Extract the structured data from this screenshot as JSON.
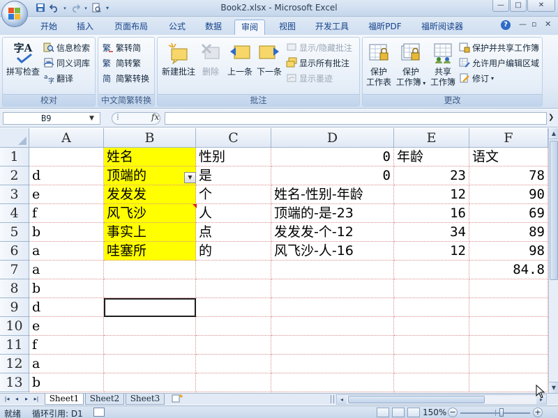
{
  "window": {
    "title": "Book2.xlsx - Microsoft Excel",
    "min_glyph": "—",
    "max_glyph": "□",
    "close_glyph": "✕"
  },
  "qat": {
    "save_icon": "save-icon",
    "undo_icon": "undo-icon",
    "redo_icon": "redo-icon"
  },
  "tabs": [
    {
      "label": "开始"
    },
    {
      "label": "插入"
    },
    {
      "label": "页面布局"
    },
    {
      "label": "公式"
    },
    {
      "label": "数据"
    },
    {
      "label": "审阅",
      "active": true
    },
    {
      "label": "视图"
    },
    {
      "label": "开发工具"
    },
    {
      "label": "福昕PDF"
    },
    {
      "label": "福昕阅读器"
    }
  ],
  "help_glyph": "?",
  "ribbon": {
    "proofing": {
      "label": "校对",
      "spell": "拼写检查",
      "spell_glyph": "字A",
      "research": "信息检索",
      "thesaurus": "同义词库",
      "translate": "翻译"
    },
    "chinese": {
      "label": "中文简繁转换",
      "to_simplified": "繁转简",
      "to_traditional": "简转繁",
      "convert": "简繁转换"
    },
    "comments": {
      "label": "批注",
      "new": "新建批注",
      "delete": "删除",
      "previous": "上一条",
      "next": "下一条",
      "show_hide": "显示/隐藏批注",
      "show_all": "显示所有批注",
      "show_ink": "显示墨迹"
    },
    "changes": {
      "label": "更改",
      "protect_sheet_1": "保护",
      "protect_sheet_2": "工作表",
      "protect_book_1": "保护",
      "protect_book_2": "工作簿",
      "share_1": "共享",
      "share_2": "工作簿",
      "protect_share": "保护并共享工作簿",
      "allow_edit": "允许用户编辑区域",
      "track": "修订"
    }
  },
  "formula_bar": {
    "name_box": "B9",
    "fx": "fx",
    "formula": ""
  },
  "columns": [
    "A",
    "B",
    "C",
    "D",
    "E",
    "F"
  ],
  "rows": [
    {
      "num": "1",
      "A": "",
      "B": "姓名",
      "C": "性别",
      "D": "0",
      "E": "年龄",
      "F": "语文"
    },
    {
      "num": "2",
      "A": "d",
      "B": "顶端的",
      "C": "是",
      "D": "0",
      "E": "23",
      "F": "78"
    },
    {
      "num": "3",
      "A": "e",
      "B": "发发发",
      "C": "个",
      "D": "姓名-性别-年龄",
      "E": "12",
      "F": "90"
    },
    {
      "num": "4",
      "A": "f",
      "B": "风飞沙",
      "C": "人",
      "D": "顶端的-是-23",
      "E": "16",
      "F": "69"
    },
    {
      "num": "5",
      "A": "b",
      "B": "事实上",
      "C": "点",
      "D": "发发发-个-12",
      "E": "34",
      "F": "89"
    },
    {
      "num": "6",
      "A": "a",
      "B": "哇塞所",
      "C": "的",
      "D": "风飞沙-人-16",
      "E": "12",
      "F": "98"
    },
    {
      "num": "7",
      "A": "a",
      "B": "",
      "C": "",
      "D": "",
      "E": "",
      "F": "84.8"
    },
    {
      "num": "8",
      "A": "b",
      "B": "",
      "C": "",
      "D": "",
      "E": "",
      "F": ""
    },
    {
      "num": "9",
      "A": "d",
      "B": "",
      "C": "",
      "D": "",
      "E": "",
      "F": ""
    },
    {
      "num": "10",
      "A": "e",
      "B": "",
      "C": "",
      "D": "",
      "E": "",
      "F": ""
    },
    {
      "num": "11",
      "A": "f",
      "B": "",
      "C": "",
      "D": "",
      "E": "",
      "F": ""
    },
    {
      "num": "12",
      "A": "a",
      "B": "",
      "C": "",
      "D": "",
      "E": "",
      "F": ""
    },
    {
      "num": "13",
      "A": "b",
      "B": "",
      "C": "",
      "D": "",
      "E": "",
      "F": ""
    }
  ],
  "highlight_color": "#ffff00",
  "sheets": [
    {
      "name": "Sheet1",
      "active": true
    },
    {
      "name": "Sheet2"
    },
    {
      "name": "Sheet3"
    }
  ],
  "status": {
    "ready": "就绪",
    "circular": "循环引用: D1",
    "zoom": "150%"
  }
}
